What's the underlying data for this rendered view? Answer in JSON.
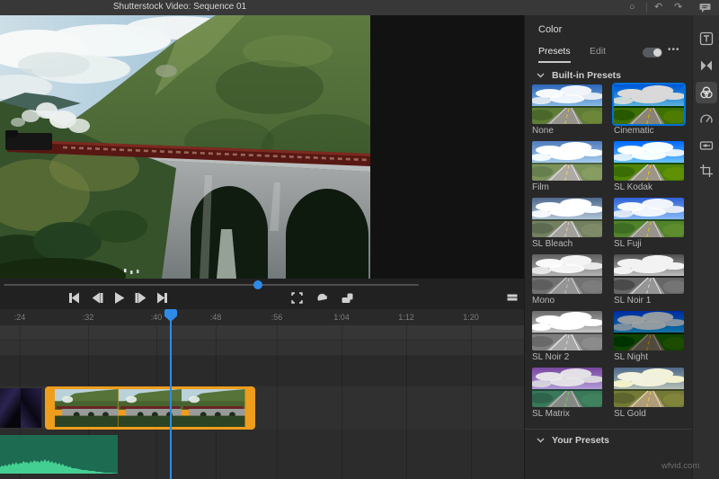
{
  "title_bar": {
    "title": "Shutterstock Video: Sequence 01",
    "icons": {
      "undo": "↶",
      "redo": "↷"
    }
  },
  "timeline": {
    "ticks": [
      ":24",
      ":32",
      ":40",
      ":48",
      ":56",
      "1:04",
      "1:12",
      "1:20"
    ]
  },
  "color_panel": {
    "title": "Color",
    "tabs": [
      {
        "label": "Presets",
        "active": true
      },
      {
        "label": "Edit",
        "active": false
      }
    ],
    "toggle_on": true,
    "more_label": "•••",
    "sections": {
      "built_in": "Built-in Presets",
      "your_presets": "Your Presets"
    },
    "presets": [
      {
        "label": "None"
      },
      {
        "label": "Cinematic",
        "selected": true
      },
      {
        "label": "Film"
      },
      {
        "label": "SL Kodak"
      },
      {
        "label": "SL Bleach"
      },
      {
        "label": "SL Fuji"
      },
      {
        "label": "Mono"
      },
      {
        "label": "SL Noir 1"
      },
      {
        "label": "SL Noir 2"
      },
      {
        "label": "SL Night"
      },
      {
        "label": "SL Matrix"
      },
      {
        "label": "SL Gold"
      }
    ]
  },
  "sidebar_tools": [
    {
      "name": "titles"
    },
    {
      "name": "transitions"
    },
    {
      "name": "color",
      "active": true
    },
    {
      "name": "speed"
    },
    {
      "name": "audio"
    },
    {
      "name": "crop-rotate"
    }
  ],
  "watermark": "wfvid.com",
  "colors": {
    "accent_blue": "#2E8BE8",
    "selection_orange": "#EE9D1C",
    "audio_green": "#44CF92",
    "preset_selected_border": "#2A7FE8"
  }
}
